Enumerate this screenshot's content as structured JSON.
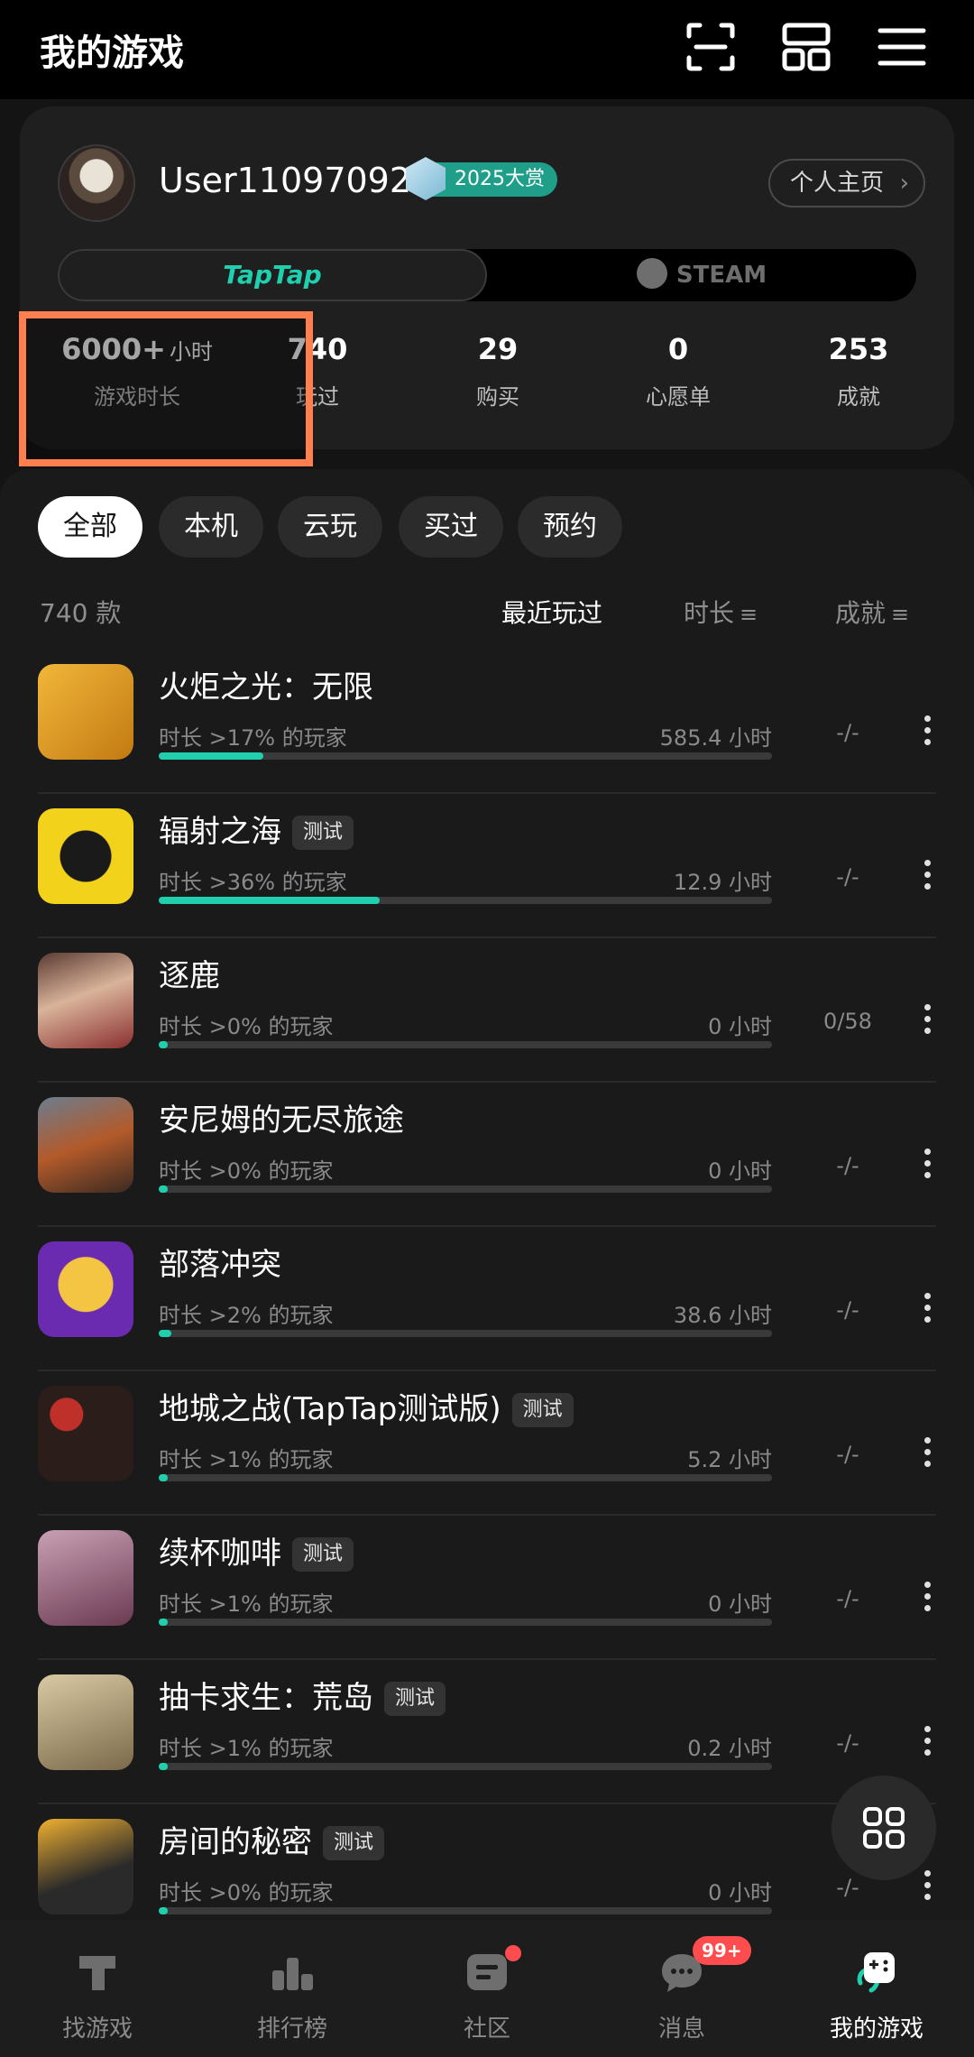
{
  "header": {
    "title": "我的游戏"
  },
  "profile": {
    "username": "User110970928",
    "award_badge": "2025大赏",
    "homepage_button": "个人主页",
    "platform_tabs": [
      "TapTap",
      "STEAM"
    ],
    "stats": [
      {
        "value": "6000+",
        "unit": "小时",
        "label": "游戏时长"
      },
      {
        "value": "740",
        "unit": "",
        "label": "玩过"
      },
      {
        "value": "29",
        "unit": "",
        "label": "购买"
      },
      {
        "value": "0",
        "unit": "",
        "label": "心愿单"
      },
      {
        "value": "253",
        "unit": "",
        "label": "成就"
      }
    ]
  },
  "filters": [
    "全部",
    "本机",
    "云玩",
    "买过",
    "预约"
  ],
  "list_header": {
    "count": "740 款",
    "sort_recent": "最近玩过",
    "sort_duration": "时长",
    "sort_achievement": "成就"
  },
  "games": [
    {
      "name": "火炬之光：无限",
      "tag": "",
      "sub": "时长 >17% 的玩家",
      "hours": "585.4 小时",
      "achievement": "-/-",
      "progress": 0.17
    },
    {
      "name": "辐射之海",
      "tag": "测试",
      "sub": "时长 >36% 的玩家",
      "hours": "12.9 小时",
      "achievement": "-/-",
      "progress": 0.36
    },
    {
      "name": "逐鹿",
      "tag": "",
      "sub": "时长 >0% 的玩家",
      "hours": "0 小时",
      "achievement": "0/58",
      "progress": 0.0
    },
    {
      "name": "安尼姆的无尽旅途",
      "tag": "",
      "sub": "时长 >0% 的玩家",
      "hours": "0 小时",
      "achievement": "-/-",
      "progress": 0.0
    },
    {
      "name": "部落冲突",
      "tag": "",
      "sub": "时长 >2% 的玩家",
      "hours": "38.6 小时",
      "achievement": "-/-",
      "progress": 0.02
    },
    {
      "name": "地城之战(TapTap测试版)",
      "tag": "测试",
      "sub": "时长 >1% 的玩家",
      "hours": "5.2 小时",
      "achievement": "-/-",
      "progress": 0.01
    },
    {
      "name": "续杯咖啡",
      "tag": "测试",
      "sub": "时长 >1% 的玩家",
      "hours": "0 小时",
      "achievement": "-/-",
      "progress": 0.01
    },
    {
      "name": "抽卡求生：荒岛",
      "tag": "测试",
      "sub": "时长 >1% 的玩家",
      "hours": "0.2 小时",
      "achievement": "-/-",
      "progress": 0.01
    },
    {
      "name": "房间的秘密",
      "tag": "测试",
      "sub": "时长 >0% 的玩家",
      "hours": "0 小时",
      "achievement": "-/-",
      "progress": 0.0
    }
  ],
  "bottom_nav": [
    {
      "label": "找游戏",
      "icon": "taptap-icon"
    },
    {
      "label": "排行榜",
      "icon": "leaderboard-icon"
    },
    {
      "label": "社区",
      "icon": "community-icon"
    },
    {
      "label": "消息",
      "icon": "message-icon",
      "badge": "99+"
    },
    {
      "label": "我的游戏",
      "icon": "my-games-icon"
    }
  ],
  "colors": {
    "accent": "#1fcfae",
    "highlight": "#ff7f4f",
    "badge": "#ff4d4f",
    "background": "#141414"
  }
}
